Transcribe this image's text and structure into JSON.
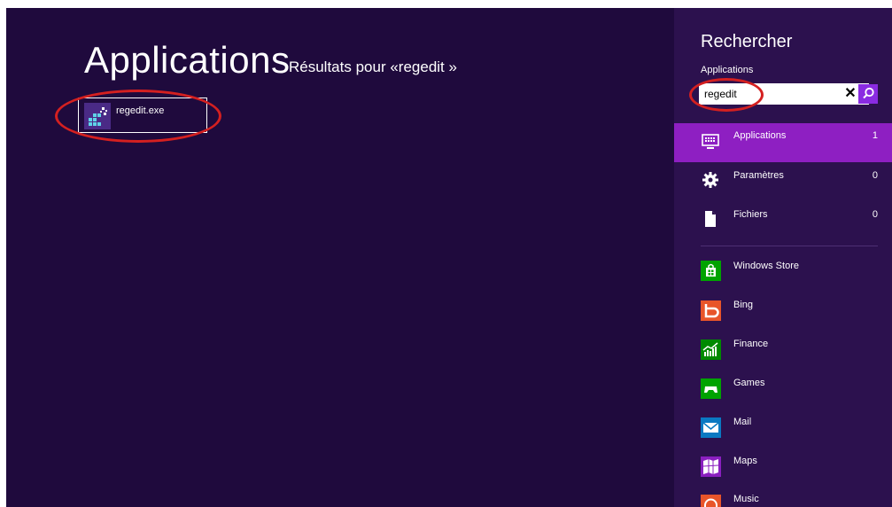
{
  "main": {
    "title": "Applications",
    "results_label": "Résultats pour «regedit »",
    "results": [
      {
        "label": "regedit.exe",
        "icon": "registry-editor-icon"
      }
    ]
  },
  "charm": {
    "title": "Rechercher",
    "scope": "Applications",
    "search": {
      "value": "regedit"
    },
    "categories": [
      {
        "label": "Applications",
        "count": "1",
        "icon": "keyboard-monitor-icon",
        "selected": true
      },
      {
        "label": "Paramètres",
        "count": "0",
        "icon": "gear-icon"
      },
      {
        "label": "Fichiers",
        "count": "0",
        "icon": "document-icon"
      }
    ],
    "apps": [
      {
        "label": "Windows Store",
        "icon": "store-bag-icon",
        "color": "#00a300"
      },
      {
        "label": "Bing",
        "icon": "bing-b-icon",
        "color": "#e8552a"
      },
      {
        "label": "Finance",
        "icon": "finance-chart-icon",
        "color": "#008a00"
      },
      {
        "label": "Games",
        "icon": "gamepad-icon",
        "color": "#00a300"
      },
      {
        "label": "Mail",
        "icon": "envelope-icon",
        "color": "#0a79c2"
      },
      {
        "label": "Maps",
        "icon": "map-icon",
        "color": "#8a1fbf"
      },
      {
        "label": "Music",
        "icon": "headphones-icon",
        "color": "#e8552a"
      }
    ]
  },
  "colors": {
    "background": "#1f0a3d",
    "charm_background": "#2c114e",
    "selected_accent": "#8e1fc2",
    "annotation": "#d42020"
  }
}
